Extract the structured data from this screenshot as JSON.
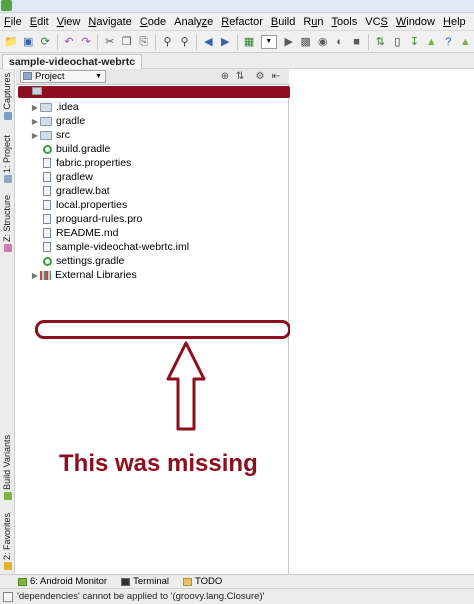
{
  "menu": [
    {
      "pre": "",
      "u": "F",
      "post": "ile"
    },
    {
      "pre": "",
      "u": "E",
      "post": "dit"
    },
    {
      "pre": "",
      "u": "V",
      "post": "iew"
    },
    {
      "pre": "",
      "u": "N",
      "post": "avigate"
    },
    {
      "pre": "",
      "u": "C",
      "post": "ode"
    },
    {
      "pre": "Analy",
      "u": "z",
      "post": "e"
    },
    {
      "pre": "",
      "u": "R",
      "post": "efactor"
    },
    {
      "pre": "",
      "u": "B",
      "post": "uild"
    },
    {
      "pre": "R",
      "u": "u",
      "post": "n"
    },
    {
      "pre": "",
      "u": "T",
      "post": "ools"
    },
    {
      "pre": "VC",
      "u": "S",
      "post": ""
    },
    {
      "pre": "",
      "u": "W",
      "post": "indow"
    },
    {
      "pre": "",
      "u": "H",
      "post": "elp"
    }
  ],
  "nav_tab": "sample-videochat-webrtc",
  "panel": {
    "selector": "Project"
  },
  "tree": [
    {
      "label": ".idea",
      "kind": "folder",
      "expandable": true
    },
    {
      "label": "gradle",
      "kind": "folder",
      "expandable": true
    },
    {
      "label": "src",
      "kind": "folder",
      "expandable": true
    },
    {
      "label": "build.gradle",
      "kind": "gradle",
      "expandable": false
    },
    {
      "label": "fabric.properties",
      "kind": "file",
      "expandable": false
    },
    {
      "label": "gradlew",
      "kind": "file",
      "expandable": false
    },
    {
      "label": "gradlew.bat",
      "kind": "file",
      "expandable": false
    },
    {
      "label": "local.properties",
      "kind": "file",
      "expandable": false
    },
    {
      "label": "proguard-rules.pro",
      "kind": "file",
      "expandable": false
    },
    {
      "label": "README.md",
      "kind": "file",
      "expandable": false
    },
    {
      "label": "sample-videochat-webrtc.iml",
      "kind": "file",
      "expandable": false
    },
    {
      "label": "settings.gradle",
      "kind": "gradle",
      "expandable": false
    }
  ],
  "external_libraries": "External Libraries",
  "side_tabs": {
    "captures": "Captures",
    "project": "1: Project",
    "structure": "Z: Structure",
    "build_variants": "Build Variants",
    "favorites": "2: Favorites"
  },
  "annotation": {
    "text": "This was missing",
    "color": "#8b0f1e"
  },
  "bottom_tabs": {
    "android_monitor": "6: Android Monitor",
    "terminal": "Terminal",
    "todo": "TODO"
  },
  "status": {
    "message": "'dependencies' cannot be applied to '(groovy.lang.Closure)'"
  }
}
